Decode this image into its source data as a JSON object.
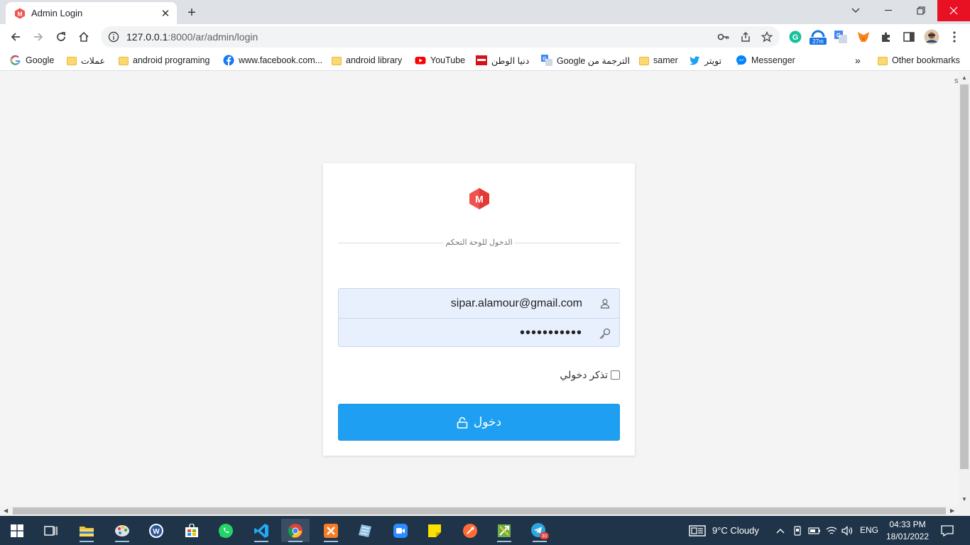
{
  "browser": {
    "tab_title": "Admin Login",
    "url_host": "127.0.0.1",
    "url_rest": ":8000/ar/admin/login",
    "extension_badge": "27m"
  },
  "bookmarks": [
    {
      "label": "Google",
      "icon": "google-icon"
    },
    {
      "label": "عملات",
      "icon": "folder-icon"
    },
    {
      "label": "android programing",
      "icon": "folder-icon"
    },
    {
      "label": "www.facebook.com...",
      "icon": "facebook-icon"
    },
    {
      "label": "android library",
      "icon": "folder-icon"
    },
    {
      "label": "YouTube",
      "icon": "youtube-icon"
    },
    {
      "label": "دنيا الوطن",
      "icon": "news-icon"
    },
    {
      "label": "Google الترجمة من",
      "icon": "translate-icon"
    },
    {
      "label": "samer",
      "icon": "folder-icon"
    },
    {
      "label": "تويتر",
      "icon": "twitter-icon"
    },
    {
      "label": "Messenger",
      "icon": "messenger-icon"
    }
  ],
  "bookmarks_more": "»",
  "other_bookmarks": "Other bookmarks",
  "login": {
    "heading": "الدخول للوحة التحكم",
    "email_value": "sipar.alamour@gmail.com",
    "password_value": "•••••••••••",
    "remember_label": "تذكر دخولي",
    "remember_checked": false,
    "submit_label": "دخول"
  },
  "colors": {
    "accent": "#1e9ff2",
    "logo": "#ef5350",
    "autofill_bg": "#e8f0fe"
  },
  "taskbar": {
    "weather": "9°C  Cloudy",
    "language": "ENG",
    "time": "04:33 PM",
    "date": "18/01/2022",
    "telegram_badge": "30"
  },
  "scroll_marker": "s"
}
